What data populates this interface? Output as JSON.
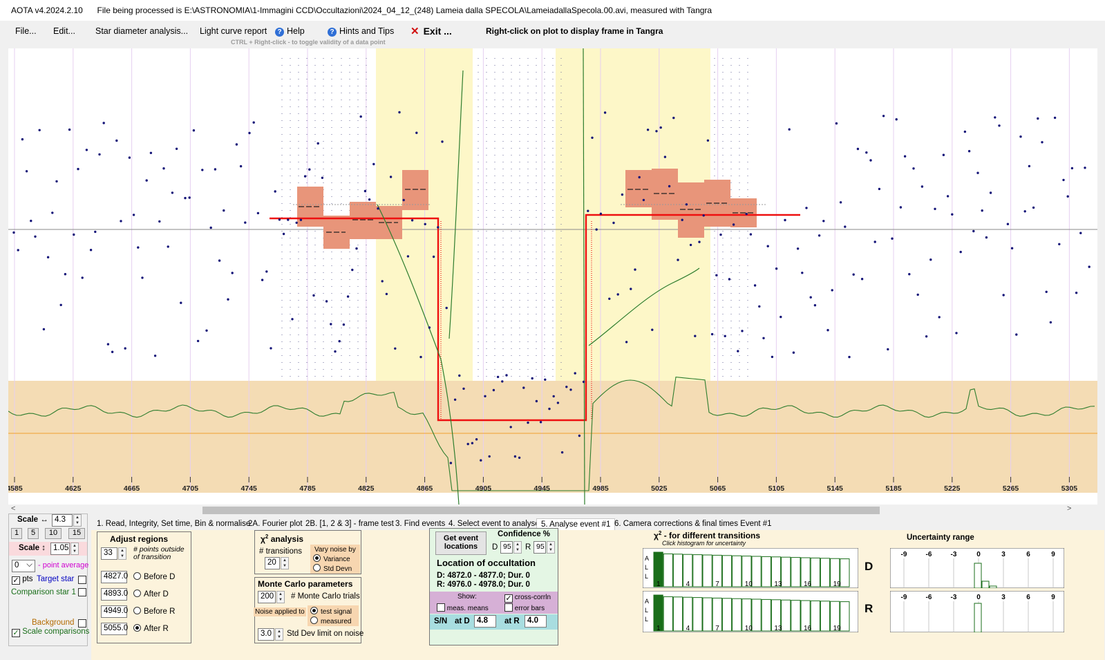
{
  "window": {
    "app": "AOTA v4.2024.2.10",
    "file_line": "File being processed is E:\\ASTRONOMIA\\1-Immagini CCD\\Occultazioni\\2024_04_12_(248) Lameia dalla SPECOLA\\LameiadallaSpecola.00.avi, measured with Tangra"
  },
  "menu": {
    "file": "File...",
    "edit": "Edit...",
    "star_diameter": "Star diameter analysis...",
    "light_curve": "Light curve report",
    "help": "Help",
    "hints": "Hints and Tips",
    "exit": "Exit ...",
    "right_click_note": "Right-click on plot to display frame in Tangra",
    "ctrl_hint": "CTRL + Right-click  -  to toggle validity of a data point"
  },
  "plot": {
    "x_ticks": [
      "4585",
      "4625",
      "4665",
      "4705",
      "4745",
      "4785",
      "4825",
      "4865",
      "4905",
      "4945",
      "4985",
      "5025",
      "5065",
      "5105",
      "5145",
      "5185",
      "5225",
      "5265",
      "5305"
    ]
  },
  "tabs": [
    "1.  Read, Integrity, Set time, Bin & normalise",
    "2A. Fourier plot",
    "2B. [1, 2 & 3] - frame test",
    "3. Find events",
    "4. Select event to analyse",
    "5. Analyse event #1",
    "6. Camera corrections & final times Event #1"
  ],
  "left": {
    "scale_h_label": "Scale ↔",
    "scale_h": "4.3",
    "scale_presets": [
      "1",
      "5",
      "10",
      "15"
    ],
    "scale_v_label": "Scale ↕",
    "scale_v": "1.05",
    "point_avg_value": "0",
    "point_avg_label": "- point average",
    "pts_label": "pts",
    "target_star": "Target star",
    "comparison_star": "Comparison star 1",
    "background": "Background",
    "scale_comparisons": "Scale comparisons"
  },
  "adjust": {
    "title": "Adjust regions",
    "points_value": "33",
    "points_label": "# points outside of transition",
    "rows": [
      {
        "value": "4827.0",
        "label": "Before D",
        "selected": false
      },
      {
        "value": "4893.0",
        "label": "After D",
        "selected": false
      },
      {
        "value": "4949.0",
        "label": "Before R",
        "selected": false
      },
      {
        "value": "5055.0",
        "label": "After R",
        "selected": true
      }
    ]
  },
  "chi2": {
    "title_prefix": "χ",
    "title_sup": "2",
    "title_suffix": "analysis",
    "transitions_label": "# transitions",
    "transitions_value": "20",
    "vary_noise_by": "Vary noise by",
    "variance": "Variance",
    "std_devn": "Std Devn"
  },
  "monte_carlo": {
    "title": "Monte Carlo parameters",
    "trials_value": "200",
    "trials_label": "# Monte Carlo trials",
    "noise_applied_to": "Noise applied to",
    "test_signal": "test signal",
    "measured": "measured",
    "std_value": "3.0",
    "std_label": "Std Dev limit on noise"
  },
  "event": {
    "get_locations": "Get event locations",
    "confidence_label": "Confidence %",
    "d_label": "D",
    "d_value": "95",
    "r_label": "R",
    "r_value": "95",
    "location_title": "Location of occultation",
    "d_line": "D: 4872.0 - 4877.0; Dur. 0",
    "r_line": "R: 4976.0 - 4978.0; Dur. 0",
    "show_label": "Show:",
    "cross_corrln": "cross-corrln",
    "meas_means": "meas. means",
    "error_bars": "error bars",
    "sn_label": "S/N",
    "at_d_label": "at D",
    "at_d_value": "4.8",
    "at_r_label": "at R",
    "at_r_value": "4.0"
  },
  "histogram": {
    "title_prefix": "χ",
    "title_sup": "2",
    "title_suffix": "- for different transitions",
    "subtitle": "Click histogram for uncertainty",
    "all_letters": [
      "A",
      "L",
      "L"
    ],
    "tick_labels": [
      "1",
      "4",
      "7",
      "10",
      "13",
      "16",
      "19"
    ],
    "d_label": "D",
    "r_label": "R"
  },
  "uncertainty": {
    "title": "Uncertainty range",
    "ticks": [
      "-9",
      "-6",
      "-3",
      "0",
      "3",
      "6",
      "9"
    ]
  },
  "colors": {
    "accent_red": "#ee1010",
    "curve_green": "#2e7d2e",
    "band_yellow": "#fdf7c8",
    "baseline_band": "#f4dcb4",
    "model_fill": "#e8957a",
    "dot": "#141478"
  }
}
